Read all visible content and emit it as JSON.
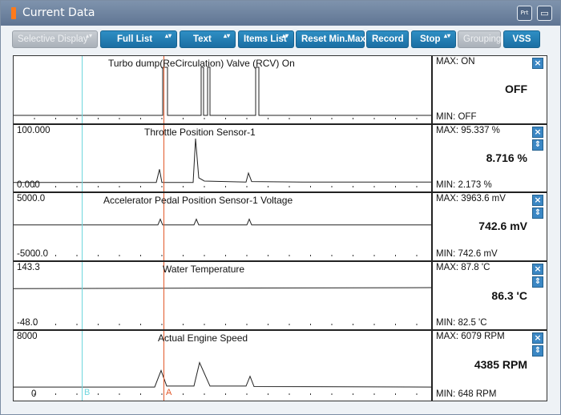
{
  "window": {
    "title": "Current Data",
    "buttons": [
      {
        "name": "print-icon",
        "symbol": "Prt"
      },
      {
        "name": "minimize-icon",
        "symbol": "▭"
      }
    ]
  },
  "toolbar": {
    "selective_display": "Selective Display",
    "full_list": "Full List",
    "text": "Text",
    "items_list": "Items List",
    "reset_min_max": "Reset Min.Max",
    "record": "Record",
    "stop": "Stop",
    "grouping": "Grouping",
    "vss": "VSS",
    "spinner_symbol": "▴▾"
  },
  "icons": {
    "close": "×",
    "move": "⇕"
  },
  "cursors": {
    "a_label": "A",
    "b_label": "B"
  },
  "graphs": [
    {
      "title": "Turbo dump(ReCirculation) Valve (RCV) On",
      "y_max_label": "",
      "y_min_label": "",
      "max": "MAX: ON",
      "min": "MIN: OFF",
      "value": "OFF",
      "has_move": false,
      "signal": [
        [
          0,
          0
        ],
        [
          186,
          0
        ],
        [
          186,
          1
        ],
        [
          192,
          1
        ],
        [
          192,
          0
        ],
        [
          234,
          0
        ],
        [
          234,
          1
        ],
        [
          237,
          1
        ],
        [
          237,
          0
        ],
        [
          242,
          0
        ],
        [
          242,
          1
        ],
        [
          245,
          1
        ],
        [
          245,
          0
        ],
        [
          302,
          0
        ],
        [
          302,
          1
        ],
        [
          306,
          1
        ],
        [
          306,
          0
        ],
        [
          523,
          0
        ]
      ]
    },
    {
      "title": "Throttle Position Sensor-1",
      "y_max_label": "100.000",
      "y_min_label": "0.000",
      "max": "MAX: 95.337 %",
      "min": "MIN: 2.173 %",
      "value": "8.716 %",
      "has_move": true,
      "signal": [
        [
          0,
          0.02
        ],
        [
          178,
          0.02
        ],
        [
          182,
          0.3
        ],
        [
          185,
          0.02
        ],
        [
          224,
          0.02
        ],
        [
          227,
          0.95
        ],
        [
          231,
          0.12
        ],
        [
          238,
          0.05
        ],
        [
          290,
          0.03
        ],
        [
          293,
          0.22
        ],
        [
          297,
          0.04
        ],
        [
          360,
          0.03
        ],
        [
          523,
          0.03
        ]
      ]
    },
    {
      "title": "Accelerator Pedal Position Sensor-1 Voltage",
      "y_max_label": "5000.0",
      "y_min_label": "-5000.0",
      "max": "MAX: 3963.6 mV",
      "min": "MIN: 742.6 mV",
      "value": "742.6 mV",
      "has_move": true,
      "signal": [
        [
          0,
          0.57
        ],
        [
          180,
          0.57
        ],
        [
          183,
          0.69
        ],
        [
          186,
          0.57
        ],
        [
          225,
          0.57
        ],
        [
          228,
          0.69
        ],
        [
          231,
          0.57
        ],
        [
          291,
          0.57
        ],
        [
          294,
          0.69
        ],
        [
          297,
          0.57
        ],
        [
          523,
          0.57
        ]
      ]
    },
    {
      "title": "Water Temperature",
      "y_max_label": "143.3",
      "y_min_label": "-48.0",
      "max": "MAX:  87.8 'C",
      "min": "MIN:  82.5 'C",
      "value": "86.3 'C",
      "has_move": true,
      "signal": [
        [
          0,
          0.68
        ],
        [
          523,
          0.7
        ]
      ]
    },
    {
      "title": "Actual Engine Speed",
      "y_max_label": "8000",
      "y_min_label": "0",
      "max": "MAX:  6079 RPM",
      "min": "MIN:   648 RPM",
      "value": "4385 RPM",
      "has_move": true,
      "signal": [
        [
          0,
          0.08
        ],
        [
          176,
          0.08
        ],
        [
          184,
          0.42
        ],
        [
          191,
          0.1
        ],
        [
          225,
          0.1
        ],
        [
          232,
          0.58
        ],
        [
          245,
          0.1
        ],
        [
          290,
          0.1
        ],
        [
          295,
          0.3
        ],
        [
          300,
          0.09
        ],
        [
          523,
          0.08
        ]
      ]
    }
  ]
}
